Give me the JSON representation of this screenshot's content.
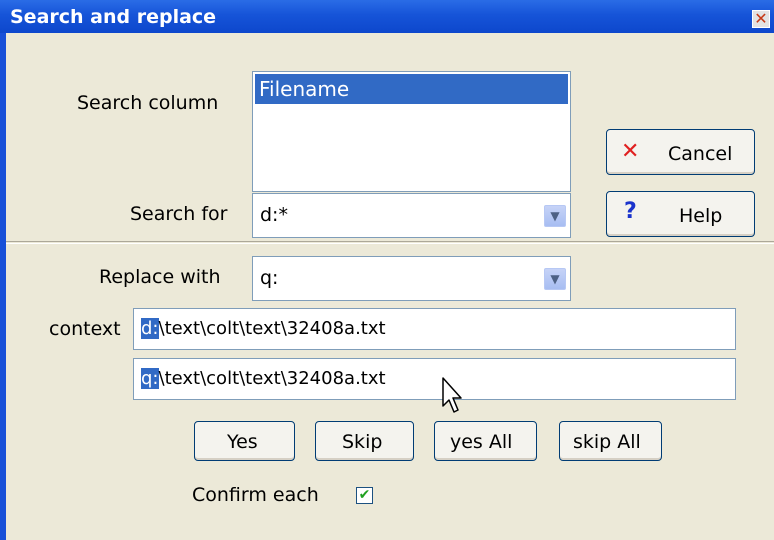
{
  "dialog": {
    "title": "Search and replace"
  },
  "search_column": {
    "label": "Search column",
    "items": [
      "Filename"
    ]
  },
  "search_for": {
    "label": "Search for",
    "value": "d:*"
  },
  "replace_with": {
    "label": "Replace with",
    "value": "q:"
  },
  "buttons": {
    "cancel": "Cancel",
    "help": "Help",
    "yes": "Yes",
    "skip": "Skip",
    "yes_all": "yes All",
    "skip_all": "skip All"
  },
  "context": {
    "label": "context",
    "original": {
      "selected": "d:",
      "rest": "\\text\\colt\\text\\32408a.txt"
    },
    "replaced": {
      "selected": "q:",
      "rest": "\\text\\colt\\text\\32408a.txt"
    }
  },
  "confirm_each": {
    "label": "Confirm each",
    "checked": true
  },
  "icons": {
    "close": "close-icon",
    "cancel": "x-icon",
    "help": "question-icon",
    "dropdown": "chevron-down-icon",
    "check": "check-icon",
    "cursor": "mouse-pointer-icon"
  },
  "colors": {
    "titlebar": "#0d47cc",
    "selection": "#316ac5",
    "background": "#ece9d8"
  }
}
